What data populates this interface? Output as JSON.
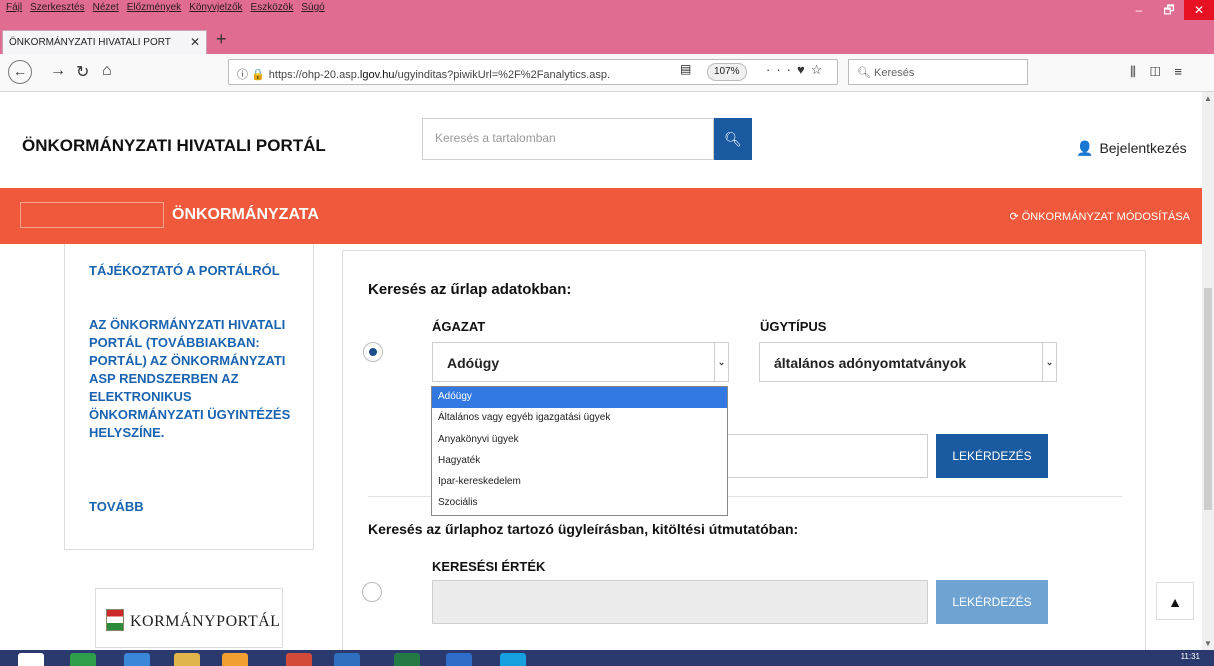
{
  "browser": {
    "menu": [
      "Fájl",
      "Szerkesztés",
      "Nézet",
      "Előzmények",
      "Könyvjelzők",
      "Eszközök",
      "Súgó"
    ],
    "tab_title": "ÖNKORMÁNYZATI HIVATALI PORT",
    "tab_close": "✕",
    "new_tab": "+",
    "url_prefix": "https://ohp-20.asp.",
    "url_host": "lgov.hu",
    "url_rest": "/ugyinditas?piwikUrl=%2F%2Fanalytics.asp.",
    "zoom": "107%",
    "search_placeholder": "Keresés",
    "win_min": "–",
    "win_max": "🗗",
    "win_close": "✕"
  },
  "page": {
    "portal_title": "ÖNKORMÁNYZATI HIVATALI PORTÁL",
    "site_search_placeholder": "Keresés a tartalomban",
    "login_label": "Bejelentkezés",
    "municipality_name": "ÖNKORMÁNYZATA",
    "change_municipality": "ÖNKORMÁNYZAT MÓDOSÍTÁSA",
    "sidebar": {
      "link1": "TÁJÉKOZTATÓ A PORTÁLRÓL",
      "link2": "AZ ÖNKORMÁNYZATI HIVATALI PORTÁL (TOVÁBBIAKBAN: PORTÁL) AZ ÖNKORMÁNYZATI ASP RENDSZERBEN AZ ELEKTRONIKUS ÖNKORMÁNYZATI ÜGYINTÉZÉS HELYSZÍNE.",
      "more": "TOVÁBB",
      "kormany": "KORMÁNYPORTÁL"
    },
    "form": {
      "heading1": "Keresés az űrlap adatokban:",
      "agazat_label": "ÁGAZAT",
      "agazat_value": "Adóügy",
      "ugytipus_label": "ÜGYTÍPUS",
      "ugytipus_value": "általános adónyomtatványok",
      "query_button": "LEKÉRDEZÉS",
      "heading2": "Keresés az űrlaphoz tartozó ügyleírásban, kitöltési útmutatóban:",
      "keresesi_label": "KERESÉSI ÉRTÉK",
      "query_button2": "LEKÉRDEZÉS"
    },
    "dropdown_options": [
      "Adóügy",
      "Általános vagy egyéb igazgatási ügyek",
      "Anyakönyvi ügyek",
      "Hagyaték",
      "Ipar-kereskedelem",
      "Szociális"
    ]
  },
  "taskbar": {
    "clock": "11:31"
  }
}
